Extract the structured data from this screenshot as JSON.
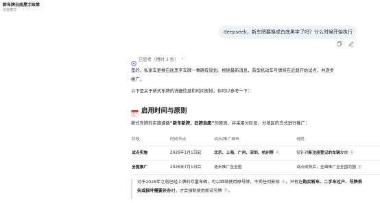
{
  "conversation": {
    "title": "新车牌白底黑字政策",
    "subtitle": "快速模式"
  },
  "user_message": {
    "text": "deepseek，新车牌要换成白底黑字了吗？什么时候开始执行",
    "actions": [
      {
        "icon": "copy-icon"
      },
      {
        "icon": "edit-icon"
      }
    ]
  },
  "thinking": {
    "label": "已思考（用时 3 秒）",
    "chevron": "›"
  },
  "answer": {
    "intro": "是的，私家车更换白底黑字车牌一事确有规划。根据最新消息，新型机动车号牌将在近期开始试点，并逐步推广。",
    "lead": "以下是关于新式车牌的详细信息和时间安排，你可以参考一下：",
    "section_title": "启用时间与原则",
    "rule_pre": "新式车牌的实施遵循",
    "rule_bold": "“新车新牌，旧牌自愿”",
    "rule_post": "的原则，并采用分阶段、分地区的方式进行推广："
  },
  "table": {
    "headers": [
      "阶段",
      "时间节点",
      "试点/推广城市",
      "说明"
    ],
    "rows": [
      {
        "stage": "试点实施",
        "date": "2026年1月1日起",
        "cities": "北京、上海、广州、深圳、杭州等",
        "cities_cite": "2",
        "note_pre": "仅针对",
        "note_bold": "新注册登记的车辆",
        "note_post": "发放",
        "note_cite": "2"
      },
      {
        "stage": "全国推广",
        "date": "2026年7月1日后",
        "cities": "逐步推广至全国",
        "cities_cite": "",
        "note_pre": "试点成熟后，全面推广至全国范围",
        "note_bold": "",
        "note_post": "",
        "note_cite": "2"
      }
    ]
  },
  "quote": {
    "p1": "对于2026年之前已经上牌的存量车辆，可以继续使用原号牌，不受任何影响",
    "c1": "4",
    "p2": "。只有在",
    "b1": "购买新车、二手车过户、号牌丢失或损坏需要补办",
    "p3": "时，才会强制使用新式号牌",
    "c2": "4",
    "p4": "。"
  },
  "colors": {
    "user_bubble": "#eef4fe",
    "accent": "#4d6bfe",
    "calendar_red": "#e0412d"
  }
}
